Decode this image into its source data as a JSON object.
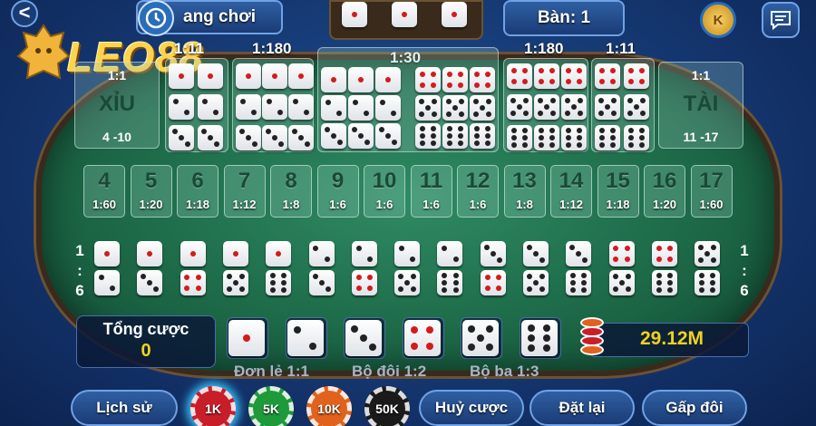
{
  "header": {
    "logo_text": "LEO88",
    "back_label": "<",
    "game_mode": "ang chơi",
    "table_label": "Bàn: 1",
    "coin_label": "K"
  },
  "small_big": {
    "small": {
      "odds": "1:1",
      "name": "XỈU",
      "range": "4 -10"
    },
    "big": {
      "odds": "1:1",
      "name": "TÀI",
      "range": "11 -17"
    }
  },
  "top_odds": {
    "specific_double_left": "1:11",
    "specific_triple_left": "1:180",
    "any_triple": "1:30",
    "specific_triple_right": "1:180",
    "specific_double_right": "1:11"
  },
  "totals": [
    {
      "n": "4",
      "o": "1:60"
    },
    {
      "n": "5",
      "o": "1:20"
    },
    {
      "n": "6",
      "o": "1:18"
    },
    {
      "n": "7",
      "o": "1:12"
    },
    {
      "n": "8",
      "o": "1:8"
    },
    {
      "n": "9",
      "o": "1:6"
    },
    {
      "n": "10",
      "o": "1:6"
    },
    {
      "n": "11",
      "o": "1:6"
    },
    {
      "n": "12",
      "o": "1:6"
    },
    {
      "n": "13",
      "o": "1:8"
    },
    {
      "n": "14",
      "o": "1:12"
    },
    {
      "n": "15",
      "o": "1:18"
    },
    {
      "n": "16",
      "o": "1:20"
    },
    {
      "n": "17",
      "o": "1:60"
    }
  ],
  "combo_odds": {
    "left": [
      "1",
      ":",
      "6"
    ],
    "right": [
      "1",
      ":",
      "6"
    ]
  },
  "bet_info": {
    "label": "Tổng cược",
    "value": "0",
    "balance": "29.12M"
  },
  "bet_types": {
    "single": "Đơn lẻ 1:1",
    "double": "Bộ đôi 1:2",
    "triple": "Bộ ba 1:3"
  },
  "chips": [
    {
      "label": "1K",
      "color": "#c81e2a"
    },
    {
      "label": "5K",
      "color": "#1f9a3b"
    },
    {
      "label": "10K",
      "color": "#e0621d"
    },
    {
      "label": "50K",
      "color": "#1a1a1a"
    }
  ],
  "buttons": {
    "history": "Lịch sử",
    "cancel": "Huỷ cược",
    "reset": "Đặt lại",
    "double": "Gấp đôi"
  },
  "colors": {
    "balance_yellow": "#f2d21e",
    "accent_blue": "#6fa2e6",
    "felt_green": "#1d6a48"
  }
}
